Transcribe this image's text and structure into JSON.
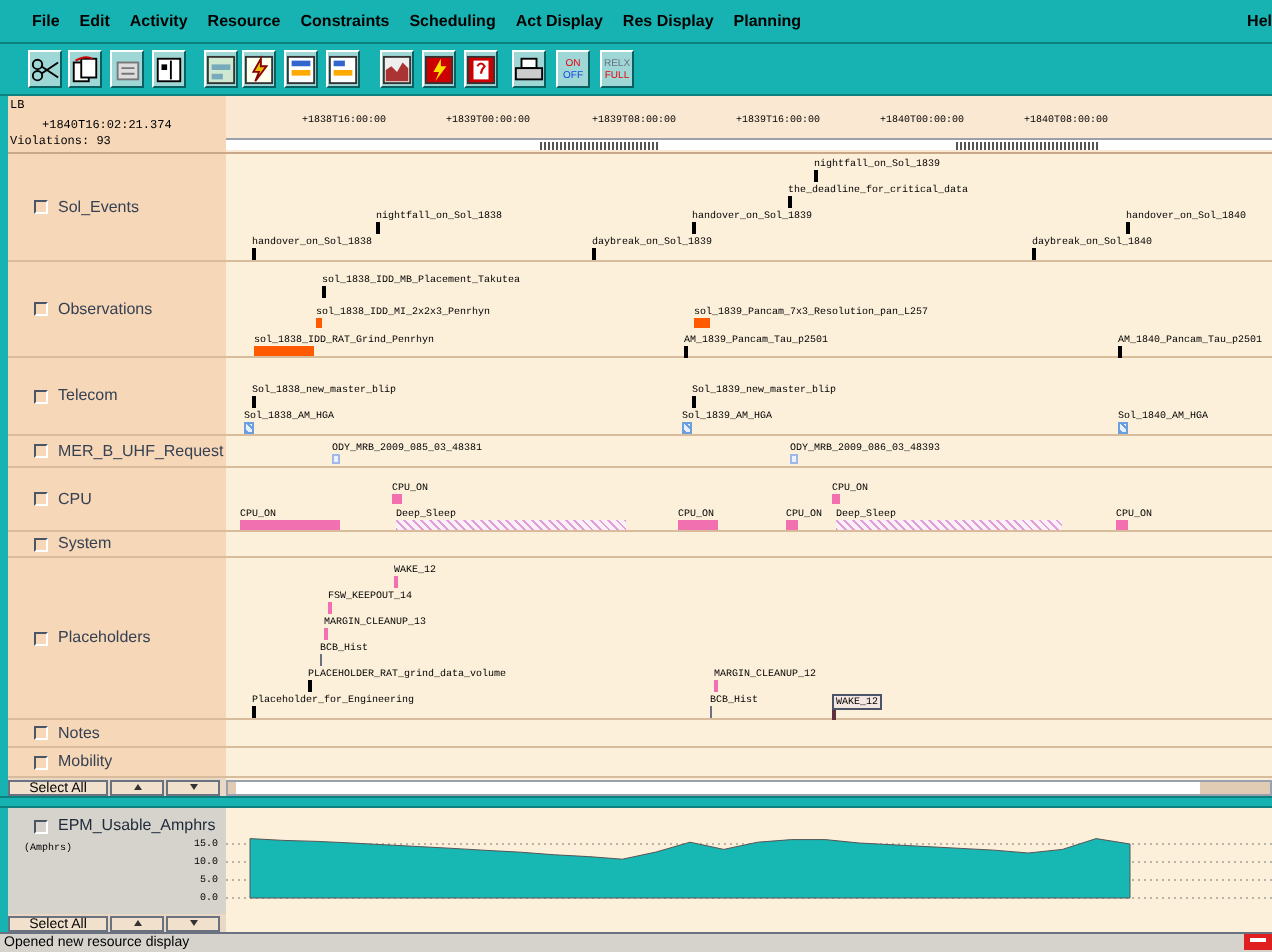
{
  "menu": [
    "File",
    "Edit",
    "Activity",
    "Resource",
    "Constraints",
    "Scheduling",
    "Act Display",
    "Res Display",
    "Planning",
    "Hel"
  ],
  "toolbar": {
    "toggles": [
      {
        "top": "ON",
        "bottom": "OFF"
      },
      {
        "top": "RELX",
        "bottom": "FULL"
      }
    ]
  },
  "header": {
    "label": "LB",
    "cursor_time": "+1840T16:02:21.374",
    "violations": "Violations: 93",
    "ticks": [
      "+1838T16:00:00",
      "+1839T00:00:00",
      "+1839T08:00:00",
      "+1839T16:00:00",
      "+1840T00:00:00",
      "+1840T08:00:00"
    ]
  },
  "rows": [
    {
      "label": "Sol_Events",
      "checked": false,
      "activities": [
        {
          "label": "nightfall_on_Sol_1839",
          "kind": "event"
        },
        {
          "label": "the_deadline_for_critical_data",
          "kind": "event"
        },
        {
          "label": "nightfall_on_Sol_1838",
          "kind": "event"
        },
        {
          "label": "handover_on_Sol_1839",
          "kind": "event"
        },
        {
          "label": "handover_on_Sol_1840",
          "kind": "event"
        },
        {
          "label": "handover_on_Sol_1838",
          "kind": "event"
        },
        {
          "label": "daybreak_on_Sol_1839",
          "kind": "event"
        },
        {
          "label": "daybreak_on_Sol_1840",
          "kind": "event"
        }
      ]
    },
    {
      "label": "Observations",
      "checked": false,
      "activities": [
        {
          "label": "sol_1838_IDD_MB_Placement_Takutea",
          "kind": "event"
        },
        {
          "label": "sol_1838_IDD_MI_2x2x3_Penrhyn",
          "kind": "obs"
        },
        {
          "label": "sol_1839_Pancam_7x3_Resolution_pan_L257",
          "kind": "obs"
        },
        {
          "label": "sol_1838_IDD_RAT_Grind_Penrhyn",
          "kind": "obs"
        },
        {
          "label": "AM_1839_Pancam_Tau_p2501",
          "kind": "event"
        },
        {
          "label": "AM_1840_Pancam_Tau_p2501",
          "kind": "event"
        }
      ]
    },
    {
      "label": "Telecom",
      "checked": false,
      "activities": [
        {
          "label": "Sol_1838_new_master_blip",
          "kind": "event"
        },
        {
          "label": "Sol_1839_new_master_blip",
          "kind": "event"
        },
        {
          "label": "Sol_1838_AM_HGA",
          "kind": "telecom"
        },
        {
          "label": "Sol_1839_AM_HGA",
          "kind": "telecom"
        },
        {
          "label": "Sol_1840_AM_HGA",
          "kind": "telecom"
        }
      ]
    },
    {
      "label": "MER_B_UHF_Request",
      "checked": false,
      "activities": [
        {
          "label": "ODY_MRB_2009_085_03_48381",
          "kind": "request"
        },
        {
          "label": "ODY_MRB_2009_086_03_48393",
          "kind": "request"
        }
      ]
    },
    {
      "label": "CPU",
      "checked": false,
      "activities": [
        {
          "label": "CPU_ON",
          "kind": "cpu"
        },
        {
          "label": "CPU_ON",
          "kind": "cpu"
        },
        {
          "label": "CPU_ON",
          "kind": "cpu"
        },
        {
          "label": "Deep_Sleep",
          "kind": "sleep"
        },
        {
          "label": "CPU_ON",
          "kind": "cpu"
        },
        {
          "label": "CPU_ON",
          "kind": "cpu"
        },
        {
          "label": "Deep_Sleep",
          "kind": "sleep"
        },
        {
          "label": "CPU_ON",
          "kind": "cpu"
        }
      ]
    },
    {
      "label": "System",
      "checked": false
    },
    {
      "label": "Placeholders",
      "checked": false,
      "activities": [
        {
          "label": "WAKE_12",
          "kind": "pink"
        },
        {
          "label": "FSW_KEEPOUT_14",
          "kind": "pink"
        },
        {
          "label": "MARGIN_CLEANUP_13",
          "kind": "pink"
        },
        {
          "label": "BCB_Hist",
          "kind": "grey"
        },
        {
          "label": "PLACEHOLDER_RAT_grind_data_volume",
          "kind": "event"
        },
        {
          "label": "MARGIN_CLEANUP_12",
          "kind": "pink"
        },
        {
          "label": "Placeholder_for_Engineering",
          "kind": "event"
        },
        {
          "label": "BCB_Hist",
          "kind": "grey"
        },
        {
          "label": "WAKE_12",
          "kind": "boxed"
        }
      ]
    },
    {
      "label": "Notes",
      "checked": false
    },
    {
      "label": "Mobility",
      "checked": false
    }
  ],
  "select_all": "Select All",
  "resource": {
    "label": "EPM_Usable_Amphrs",
    "checked": false,
    "unit": "(Amphrs)",
    "tick_labels": [
      "15.0",
      "10.0",
      "5.0",
      "0.0"
    ]
  },
  "select_all_2": "Select All",
  "status_bar": "Opened new resource display"
}
